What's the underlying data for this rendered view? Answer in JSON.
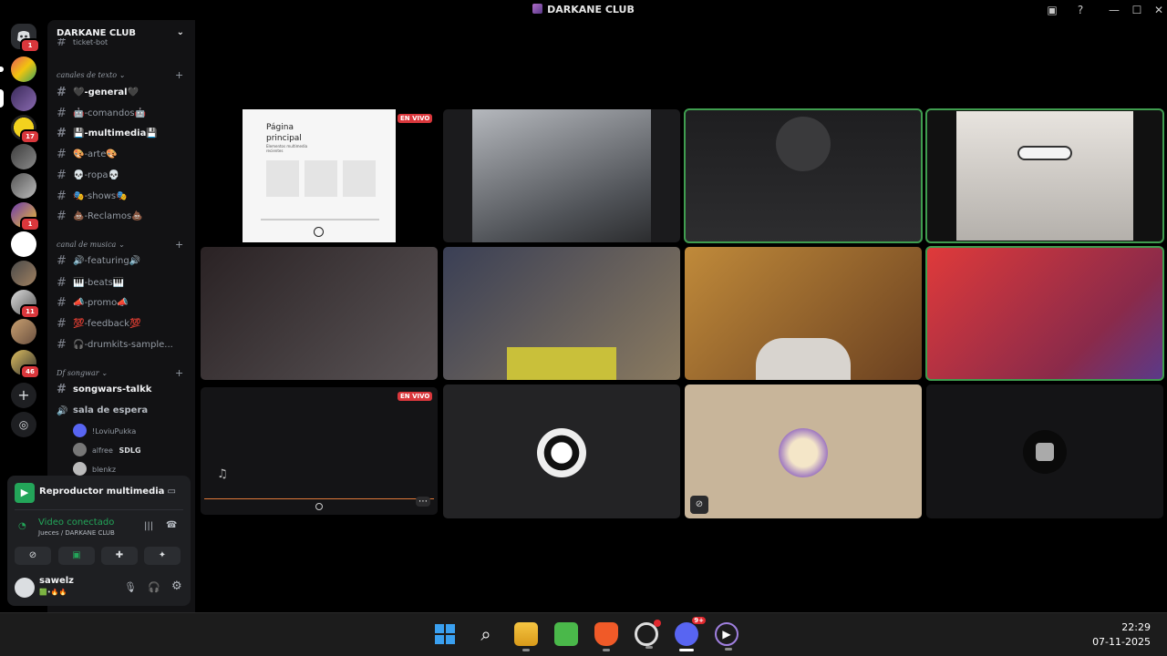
{
  "window": {
    "title": "DARKANE CLUB"
  },
  "server": {
    "name": "DARKANE CLUB",
    "partial_channel": "ticket-bot"
  },
  "rail_badges": [
    "1",
    "17",
    "1",
    "11",
    "46"
  ],
  "categories": [
    {
      "name": "canales de texto",
      "channels": [
        "🖤-general🖤",
        "🤖-comandos🤖",
        "💾-multimedia💾",
        "🎨-arte🎨",
        "💀-ropa💀",
        "🎭-shows🎭",
        "💩-Reclamos💩"
      ]
    },
    {
      "name": "canal de musica",
      "channels": [
        "🔊-featuring🔊",
        "🎹-beats🎹",
        "📣-promo📣",
        "💯-feedback💯",
        "🎧-drumkits-sample..."
      ]
    },
    {
      "name": "Df songwar",
      "channels": [
        "songwars-talkk"
      ]
    }
  ],
  "voice_channel": {
    "name": "sala de espera",
    "users": [
      "!LoviuPukka",
      "alfree",
      "blenkz"
    ],
    "user_tag": "SDLG"
  },
  "media_player": {
    "label": "Reproductor multimedia"
  },
  "connection": {
    "status": "Video conectado",
    "location": "Jueces / DARKANE CLUB"
  },
  "user": {
    "name": "sawelz"
  },
  "tiles": [
    {
      "live": "EN VIVO",
      "screen_title": "Página principal",
      "screen_subtitle": "Elementos multimedia recientes"
    },
    {
      "live": "EN VIVO"
    }
  ],
  "taskbar": {
    "time": "22:29",
    "date": "07-11-2025",
    "discord_badge": "9+"
  },
  "colors": {
    "speaking": "#3f9d4f",
    "live": "#da373c",
    "online": "#23a559"
  }
}
